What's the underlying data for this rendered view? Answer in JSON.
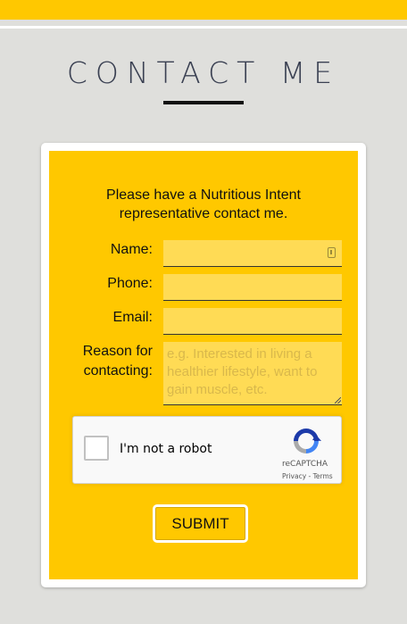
{
  "header": {
    "title": "CONTACT ME"
  },
  "form": {
    "intro": "Please have a Nutritious Intent representative contact me.",
    "labels": {
      "name": "Name:",
      "phone": "Phone:",
      "email": "Email:",
      "reason_line1": "Reason for",
      "reason_line2": "contacting:"
    },
    "values": {
      "name": "",
      "phone": "",
      "email": ""
    },
    "reason_placeholder": "e.g. Interested in living a healthier lifestyle, want to gain muscle, etc.",
    "recaptcha": {
      "label": "I'm not a robot",
      "brand": "reCAPTCHA",
      "links": "Privacy - Terms",
      "checked": false
    },
    "submit_label": "SUBMIT"
  },
  "colors": {
    "accent": "#ffc800",
    "field_bg": "#ffdb55",
    "page_bg": "#dfdfdc",
    "title": "#3a4052"
  },
  "icons": [
    "contact-card-icon",
    "recaptcha-logo-icon"
  ]
}
